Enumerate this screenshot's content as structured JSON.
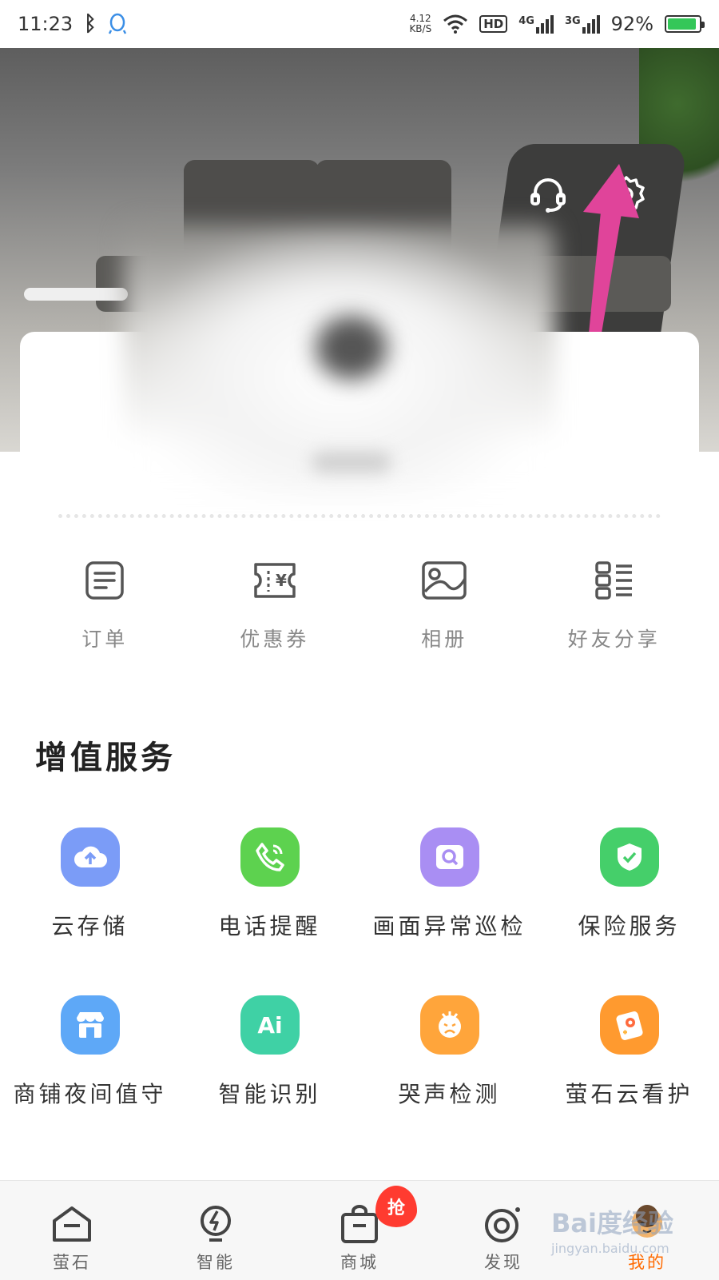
{
  "status_bar": {
    "time": "11:23",
    "speed_value": "4.12",
    "speed_unit": "KB/S",
    "hd": "HD",
    "net1": "4G",
    "net2": "3G",
    "battery": "92%",
    "battery_level": 0.92
  },
  "quick_actions": [
    {
      "label": "订单",
      "icon": "order-icon"
    },
    {
      "label": "优惠券",
      "icon": "coupon-icon"
    },
    {
      "label": "相册",
      "icon": "album-icon"
    },
    {
      "label": "好友分享",
      "icon": "friend-share-icon"
    }
  ],
  "services": {
    "title": "增值服务",
    "items": [
      {
        "label": "云存储",
        "icon": "cloud-storage-icon",
        "color": "#7b9cf7"
      },
      {
        "label": "电话提醒",
        "icon": "phone-icon",
        "color": "#5dd24f"
      },
      {
        "label": "画面异常巡检",
        "icon": "image-inspect-icon",
        "color": "#a98ef3"
      },
      {
        "label": "保险服务",
        "icon": "shield-icon",
        "color": "#45cf6a"
      },
      {
        "label": "商铺夜间值守",
        "icon": "shop-icon",
        "color": "#5ea8f7"
      },
      {
        "label": "智能识别",
        "icon": "ai-icon",
        "color": "#3fd1a5"
      },
      {
        "label": "哭声检测",
        "icon": "cry-detect-icon",
        "color": "#ffa53b"
      },
      {
        "label": "萤石云看护",
        "icon": "cloud-care-icon",
        "color": "#ff9a2f"
      }
    ]
  },
  "nav": [
    {
      "label": "萤石",
      "icon": "home-icon"
    },
    {
      "label": "智能",
      "icon": "smart-icon"
    },
    {
      "label": "商城",
      "icon": "shop-bag-icon",
      "badge": "抢"
    },
    {
      "label": "发现",
      "icon": "discover-icon"
    },
    {
      "label": "我的",
      "icon": "profile-icon"
    }
  ],
  "watermark": {
    "text": "Bai度经验",
    "sub": "jingyan.baidu.com"
  }
}
